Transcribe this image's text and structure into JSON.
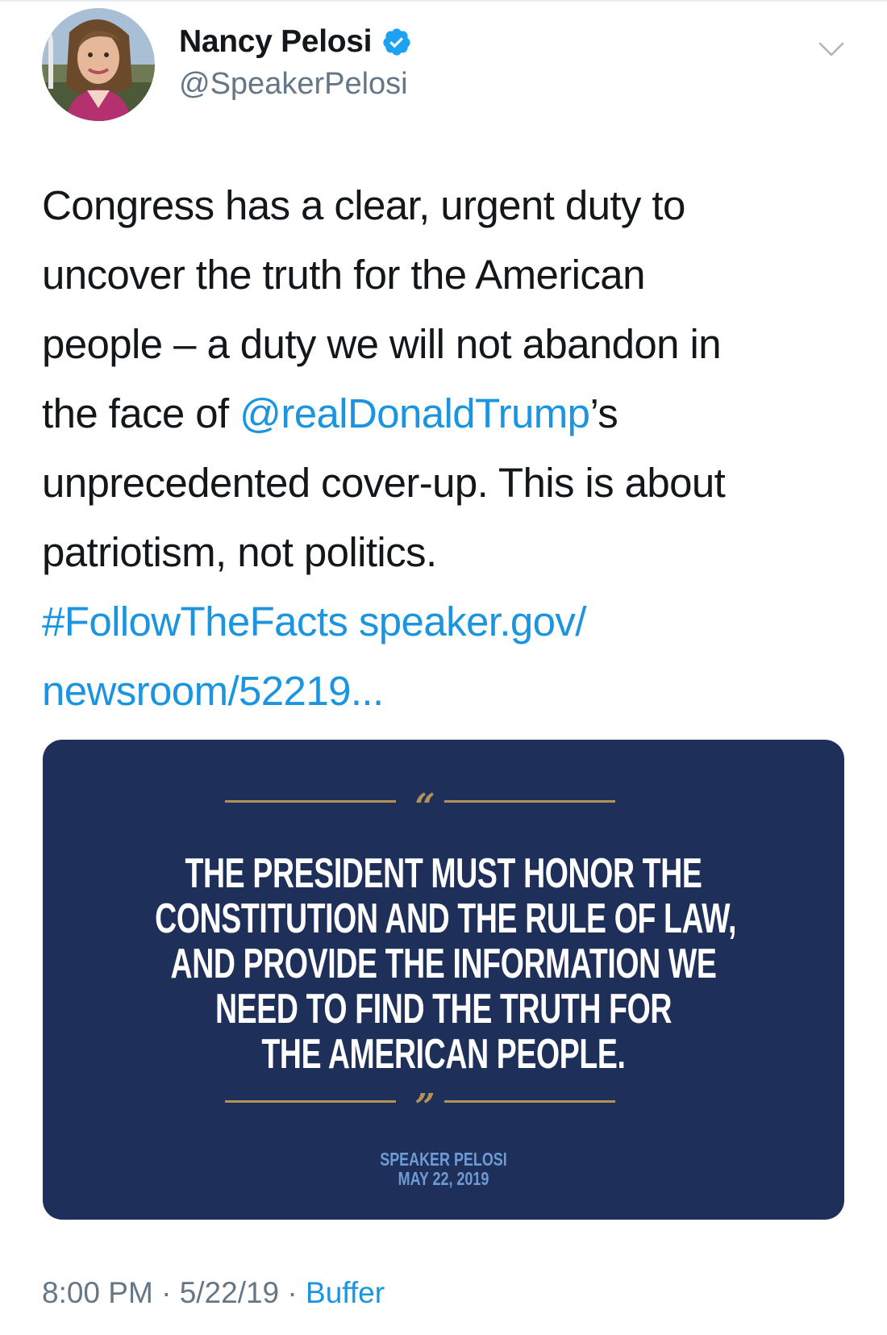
{
  "author": {
    "display_name": "Nancy Pelosi",
    "handle": "@SpeakerPelosi",
    "verified": true,
    "avatar_icon": "profile-photo"
  },
  "tweet": {
    "lines": [
      [
        "Congress has a clear, urgent duty to"
      ],
      [
        "uncover the truth for the American"
      ],
      [
        "people – a duty we will not abandon in"
      ],
      [
        "the face of ",
        "@realDonaldTrump",
        "’s"
      ],
      [
        "unprecedented cover-up. This is about"
      ],
      [
        "patriotism, not politics."
      ],
      [
        "#FollowTheFacts",
        " ",
        "speaker.gov/"
      ],
      [
        "newsroom/52219..."
      ]
    ],
    "mention": "@realDonaldTrump",
    "hashtag": "#FollowTheFacts",
    "link_part1": "speaker.gov/",
    "link_part2": "newsroom/52219..."
  },
  "card": {
    "open_quote": "“",
    "close_quote": "”",
    "quote_lines": [
      "THE PRESIDENT MUST HONOR THE",
      "CONSTITUTION AND THE RULE OF LAW,",
      "AND PROVIDE THE INFORMATION WE",
      "NEED TO FIND THE TRUTH FOR",
      "THE AMERICAN PEOPLE."
    ],
    "attribution_name": "SPEAKER PELOSI",
    "attribution_date": "MAY 22, 2019",
    "colors": {
      "background": "#1e2f5a",
      "accent": "#b39255",
      "attribution": "#6f9ad3"
    }
  },
  "meta": {
    "time": "8:00 PM",
    "separator": " · ",
    "date": "5/22/19",
    "source": "Buffer"
  },
  "colors": {
    "link": "#1b95e0",
    "secondary_text": "#657786",
    "verified_badge": "#1da1f2"
  }
}
